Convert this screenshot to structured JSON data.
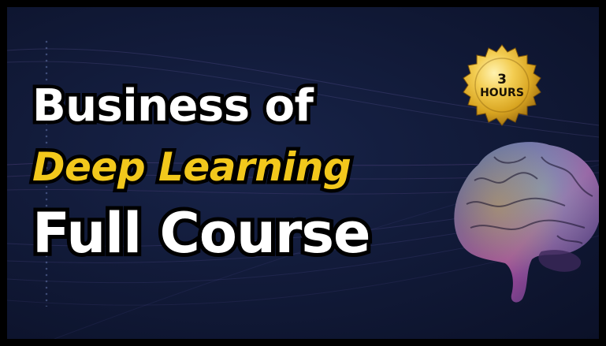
{
  "headline": {
    "line1": "Business of",
    "line2": "Deep Learning",
    "line3": "Full Course"
  },
  "badge": {
    "number": "3",
    "unit": "HOURS"
  },
  "colors": {
    "background": "#121b3a",
    "accent_yellow": "#f2c81c",
    "text_white": "#ffffff",
    "outline": "#000000",
    "badge_gold": "#d9a521"
  },
  "illustration": "brain-icon"
}
